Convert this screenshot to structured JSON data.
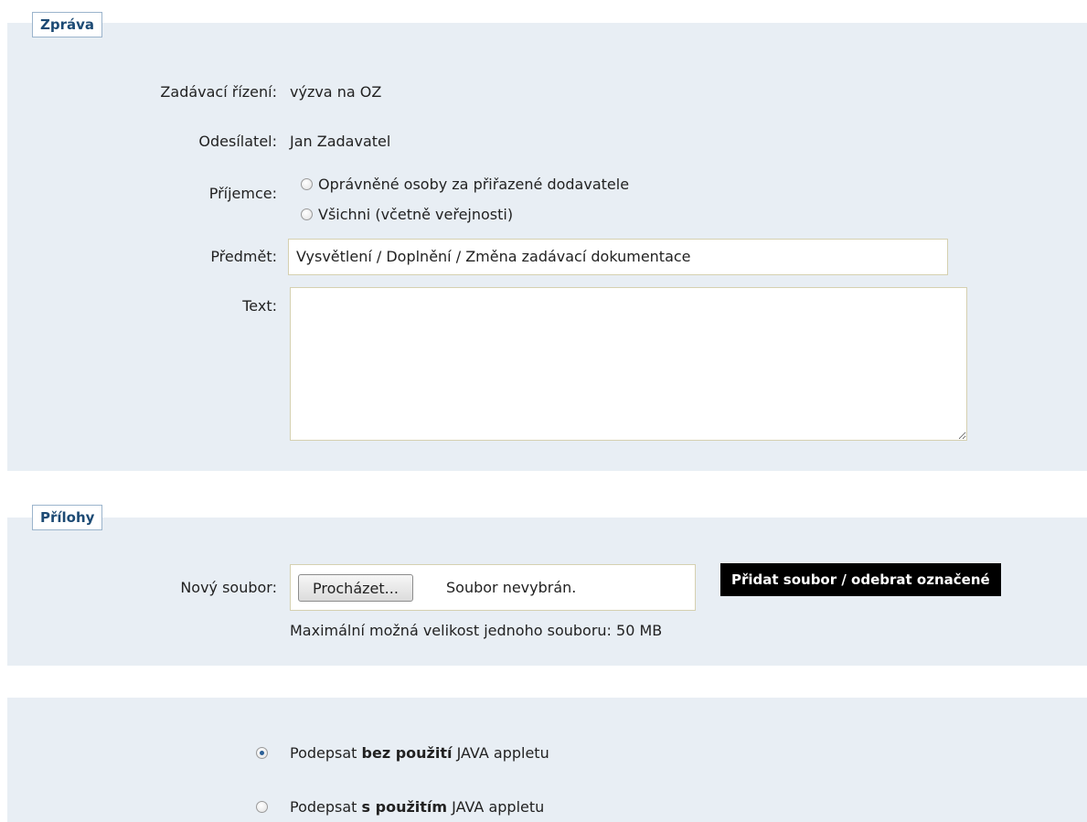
{
  "message_section": {
    "legend": "Zpráva",
    "procedure_label": "Zadávací řízení:",
    "procedure_value": "výzva na OZ",
    "sender_label": "Odesílatel:",
    "sender_value": "Jan Zadavatel",
    "recipient_label": "Příjemce:",
    "recipient_options": [
      {
        "label": "Oprávněné osoby za přiřazené dodavatele",
        "selected": false
      },
      {
        "label": "Všichni (včetně veřejnosti)",
        "selected": false
      }
    ],
    "subject_label": "Předmět:",
    "subject_value": "Vysvětlení / Doplnění / Změna zadávací dokumentace",
    "text_label": "Text:",
    "text_value": ""
  },
  "attachments_section": {
    "legend": "Přílohy",
    "new_file_label": "Nový soubor:",
    "browse_button": "Procházet...",
    "no_file_text": "Soubor nevybrán.",
    "add_remove_button": "Přidat soubor / odebrat označené",
    "max_size_note": "Maximální možná velikost jednoho souboru: 50 MB"
  },
  "sign_section": {
    "options": [
      {
        "prefix": "Podepsat ",
        "bold": "bez použití",
        "suffix": " JAVA appletu",
        "selected": true
      },
      {
        "prefix": "Podepsat ",
        "bold": "s použitím",
        "suffix": " JAVA appletu",
        "selected": false
      }
    ]
  },
  "colors": {
    "panel_background": "#e8eef4",
    "legend_text": "#1c4a74",
    "button_dark": "#000000"
  }
}
